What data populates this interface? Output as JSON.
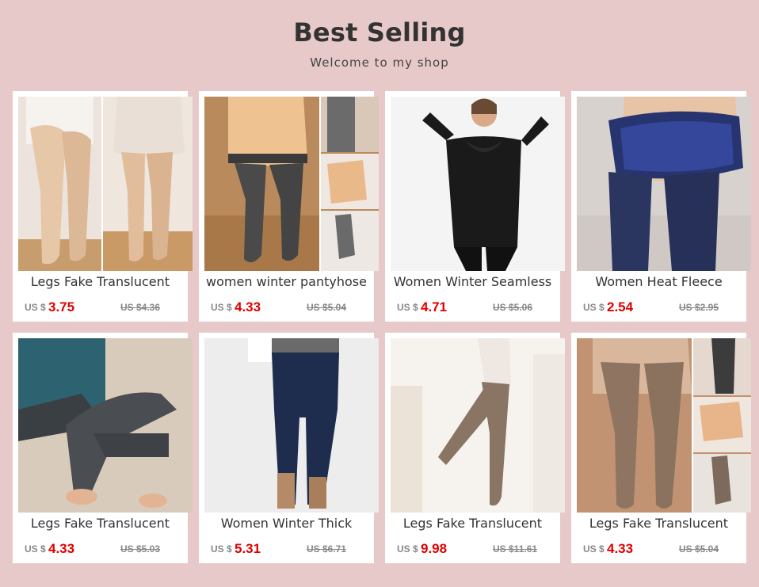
{
  "header": {
    "title": "Best Selling",
    "subtitle": "Welcome to my shop"
  },
  "currency": "US $",
  "products": [
    {
      "name": "Legs Fake Translucent",
      "price": "3.75",
      "old_price": "US $4.36",
      "image": "beige-tights-photo"
    },
    {
      "name": "women winter pantyhose",
      "price": "4.33",
      "old_price": "US $5.04",
      "image": "fleece-lined-tights-collage"
    },
    {
      "name": "Women Winter Seamless",
      "price": "4.71",
      "old_price": "US $5.06",
      "image": "black-thermal-bodysuit-photo"
    },
    {
      "name": "Women Heat Fleece",
      "price": "2.54",
      "old_price": "US $2.95",
      "image": "navy-fleece-leggings-photo"
    },
    {
      "name": "Legs Fake Translucent",
      "price": "4.33",
      "old_price": "US $5.03",
      "image": "grey-stirrup-leggings-photo"
    },
    {
      "name": "Women Winter Thick",
      "price": "5.31",
      "old_price": "US $6.71",
      "image": "dark-jeans-leggings-photo"
    },
    {
      "name": "Legs Fake Translucent",
      "price": "9.98",
      "old_price": "US $11.61",
      "image": "sheer-tights-photo"
    },
    {
      "name": "Legs Fake Translucent",
      "price": "4.33",
      "old_price": "US $5.04",
      "image": "tan-tights-collage"
    }
  ]
}
